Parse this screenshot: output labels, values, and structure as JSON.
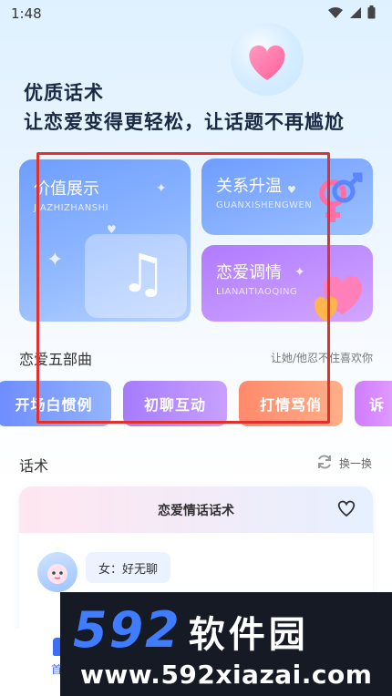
{
  "status_bar": {
    "time": "1:48"
  },
  "header": {
    "headline_1": "优质话术",
    "headline_2": "让恋爱变得更轻松，让话题不再尴尬"
  },
  "cards": {
    "value": {
      "title": "价值展示",
      "subtitle": "JIAZHIZHANSHI"
    },
    "relation": {
      "title": "关系升温",
      "subtitle": "GUANXISHENGWEN"
    },
    "love": {
      "title": "恋爱调情",
      "subtitle": "LIANAITIAOQING"
    }
  },
  "five_part": {
    "title": "恋爱五部曲",
    "hint": "让她/他忍不住喜欢你",
    "chips": [
      "开场白惯例",
      "初聊互动",
      "打情骂俏",
      "诉"
    ]
  },
  "phrases": {
    "title": "话术",
    "refresh_label": "换一换",
    "card_title": "恋爱情话话术",
    "message": "女：好无聊"
  },
  "bottom_nav": {
    "home_label": "首"
  },
  "watermark": {
    "number": "592",
    "brand": "软件园",
    "url": "www.592xiazai.com"
  },
  "colors": {
    "accent": "#3f6ef5",
    "annotation_box": "#e0312c"
  }
}
